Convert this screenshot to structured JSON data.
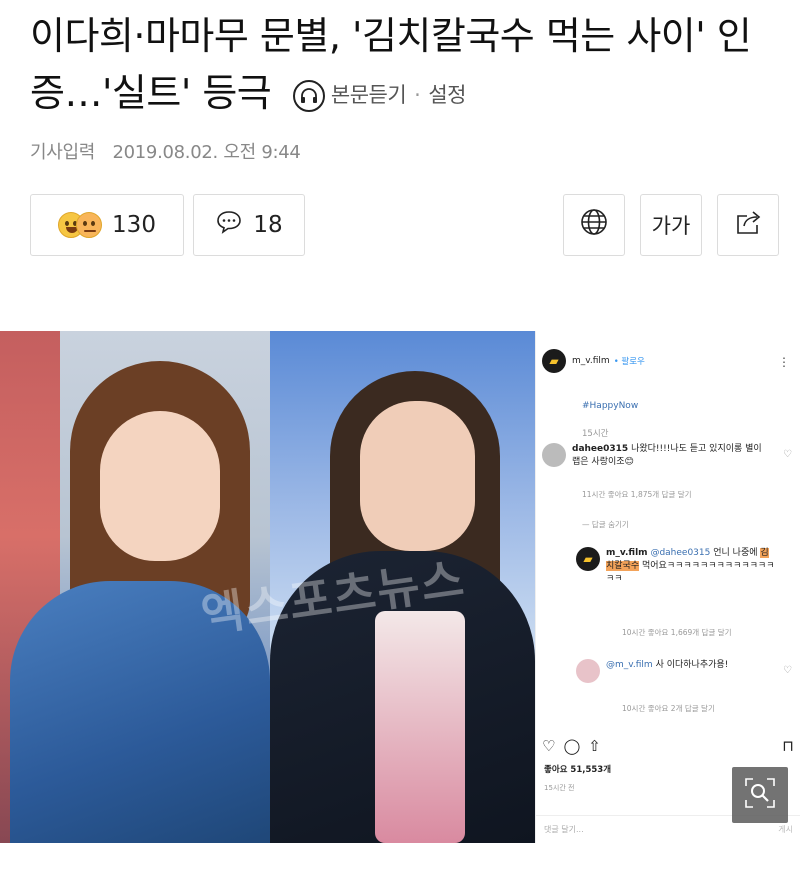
{
  "article": {
    "title": "이다희·마마무 문별, '김치칼국수 먹는 사이' 인증…'실트' 등극",
    "tts_label": "본문듣기",
    "separator": "·",
    "settings_label": "설정",
    "date_label": "기사입력",
    "date_value": "2019.08.02. 오전 9:44"
  },
  "toolbar": {
    "reactions_count": "130",
    "comments_count": "18",
    "font_label": "가가"
  },
  "photo": {
    "watermark": "엑스포츠뉴스",
    "instagram": {
      "username": "m_v.film",
      "follow_label": "• 팔로우",
      "hashtag": "#HappyNow",
      "post_time": "15시간",
      "comment1_user": "dahee0315",
      "comment1_text": "나왔다!!!!나도 듣고 있지이롱 별이 랩은 사랑이조😊",
      "comment1_meta": "11시간   좋아요 1,875개   답글 달기",
      "hide_replies": "— 답글 숨기기",
      "reply1_user": "m_v.film",
      "reply1_mention": "@dahee0315",
      "reply1_text_a": "언니 나중에",
      "reply1_highlight": "김치칼국수",
      "reply1_text_b": "먹어요ㅋㅋㅋㅋㅋㅋㅋㅋㅋㅋㅋㅋㅋㅋㅋ",
      "reply1_meta": "10시간   좋아요 1,669개   답글 달기",
      "reply2_mention": "@m_v.film",
      "reply2_text": "사 이다하나추가용!",
      "reply2_meta": "10시간   좋아요 2개   답글 달기",
      "likes": "좋아요 51,553개",
      "date": "15시간 전",
      "input_placeholder": "댓글 달기...",
      "post_label": "게시"
    }
  },
  "icons": {
    "tts": "headphones-icon",
    "globe": "globe-icon",
    "share": "share-icon",
    "comment": "speech-bubble-icon",
    "zoom": "magnifier-icon"
  }
}
